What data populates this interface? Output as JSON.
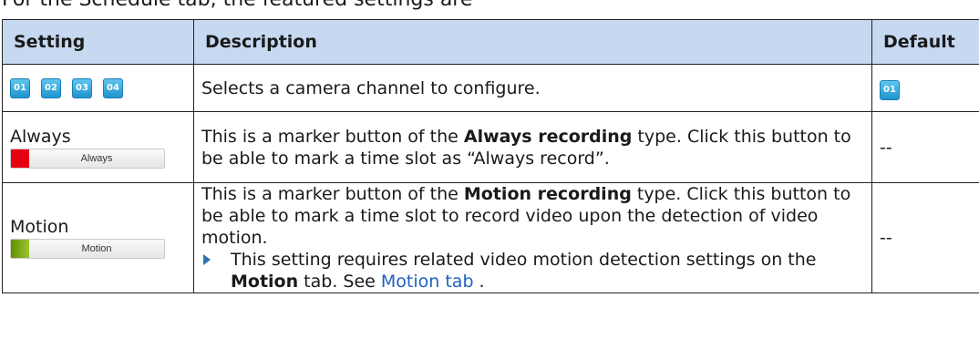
{
  "intro": "For the Schedule tab, the featured settings are",
  "table": {
    "headers": {
      "setting": "Setting",
      "description": "Description",
      "default": "Default"
    },
    "rows": [
      {
        "channels": [
          "01",
          "02",
          "03",
          "04"
        ],
        "description": "Selects a camera channel to configure.",
        "default_chip": "01"
      },
      {
        "setting_label": "Always",
        "button_label": "Always",
        "swatch_color": "#e60012",
        "desc_pre": "This is a marker button of the ",
        "desc_bold": "Always recording",
        "desc_post": " type. Click this button to be able to mark a time slot as “Always record”.",
        "default": "--"
      },
      {
        "setting_label": "Motion",
        "button_label": "Motion",
        "swatch_color": "#7fb300",
        "desc_pre": "This is a marker button of the ",
        "desc_bold": "Motion recording",
        "desc_post": " type. Click this button to be able to mark a time slot to record video upon the detection of video motion.",
        "bullet_pre": "This setting requires related video motion detection settings on the ",
        "bullet_bold": "Motion",
        "bullet_mid": " tab. See ",
        "bullet_link": "Motion tab",
        "bullet_end": " .",
        "default": "--"
      }
    ]
  }
}
